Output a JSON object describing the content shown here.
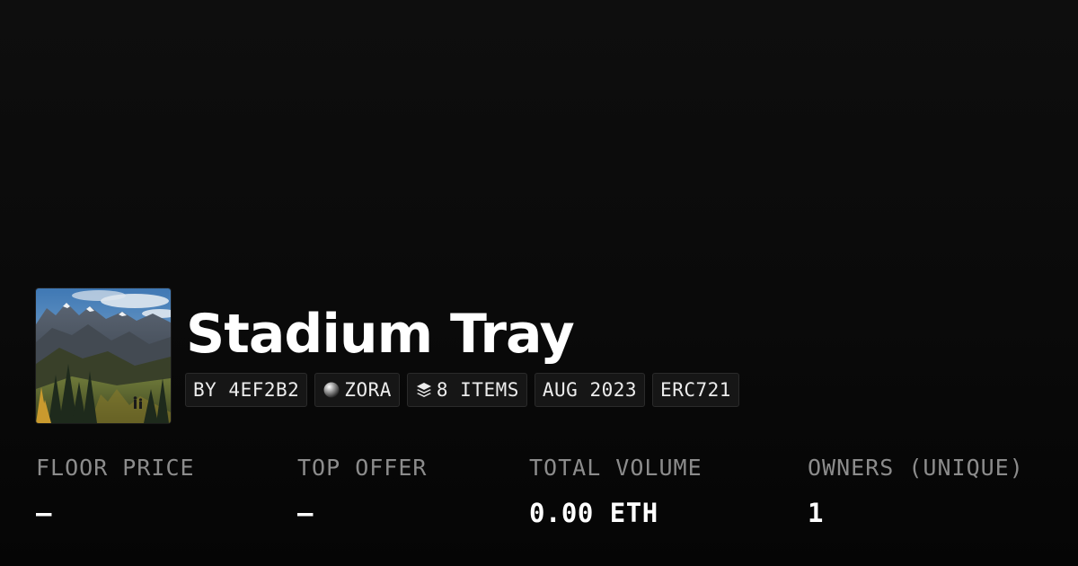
{
  "collection": {
    "title": "Stadium Tray",
    "thumbnail_icon": "mountain-landscape-image"
  },
  "tags": {
    "creator": "BY 4EF2B2",
    "chain": "ZORA",
    "chain_icon": "zora-orb-icon",
    "items": "8 ITEMS",
    "items_icon": "layers-icon",
    "date": "AUG 2023",
    "standard": "ERC721"
  },
  "stats": {
    "floor_price": {
      "label": "FLOOR PRICE",
      "value": "–"
    },
    "top_offer": {
      "label": "TOP OFFER",
      "value": "–"
    },
    "total_volume": {
      "label": "TOTAL VOLUME",
      "value": "0.00 ETH"
    },
    "owners": {
      "label": "OWNERS (UNIQUE)",
      "value": "1"
    }
  },
  "colors": {
    "background": "#0a0a0a",
    "title": "#ffffff",
    "stat_label": "#8c8c8c",
    "tag_background": "#161616",
    "tag_border": "#2a2a2a"
  }
}
